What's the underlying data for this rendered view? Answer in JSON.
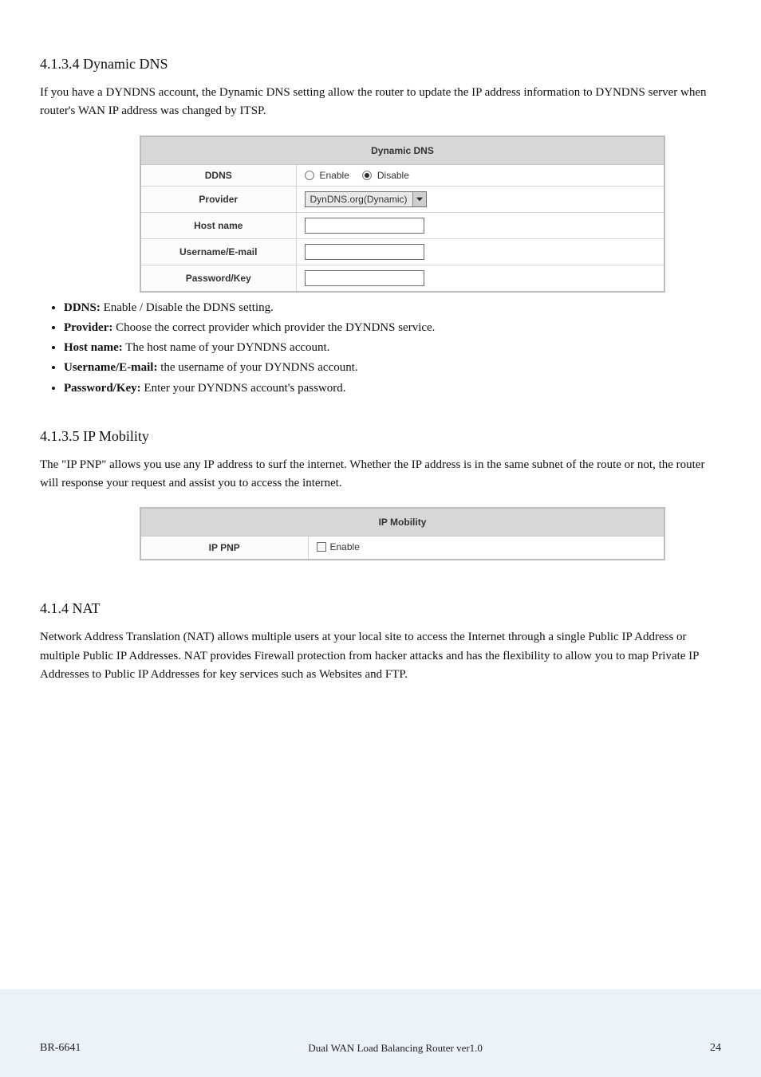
{
  "page_title": "4.1.3.4 Dynamic DNS",
  "ddns": {
    "intro": "If you have a DYNDNS account, the Dynamic DNS setting allow the router to update the IP address information to DYNDNS server when router's WAN IP address was changed by ITSP.",
    "table_header": "Dynamic DNS",
    "rows": {
      "ddns_label": "DDNS",
      "provider_label": "Provider",
      "hostname_label": "Host name",
      "username_label": "Username/E-mail",
      "password_label": "Password/Key"
    },
    "radio": {
      "enable_label": "Enable",
      "disable_label": "Disable",
      "selected": "disable"
    },
    "select": {
      "value": "DynDNS.org(Dynamic)"
    },
    "inputs": {
      "hostname": "",
      "username": "",
      "password": ""
    },
    "bullets": [
      {
        "bold": "DDNS:",
        "text": " Enable / Disable the DDNS setting."
      },
      {
        "bold": "Provider:",
        "text": " Choose the correct provider which provider the DYNDNS service."
      },
      {
        "bold": "Host name:",
        "text": " The host name of your DYNDNS account."
      },
      {
        "bold": "Username/E-mail:",
        "text": " the username of your DYNDNS account."
      },
      {
        "bold": "Password/Key:",
        "text": " Enter your DYNDNS account's password."
      }
    ]
  },
  "ipmobility": {
    "heading": "4.1.3.5 IP Mobility",
    "intro": "The \"IP PNP\" allows you use any IP address to surf the internet. Whether the IP address is in the same subnet of the route or not, the router will response your request and assist you to access the internet.",
    "table_header": "IP Mobility",
    "row_label": "IP PNP",
    "checkbox_label": "Enable",
    "checkbox_checked": false
  },
  "nat": {
    "heading": "4.1.4 NAT",
    "intro": "Network Address Translation (NAT) allows multiple users at your local site to access the Internet through a single Public IP Address or multiple Public IP Addresses. NAT provides Firewall protection from hacker attacks and has the flexibility to allow you to map Private IP Addresses to Public IP Addresses for key services such as Websites and FTP."
  },
  "footer": {
    "left": "BR-6641",
    "center": "Dual WAN Load Balancing Router ver1.0",
    "right": "24"
  }
}
